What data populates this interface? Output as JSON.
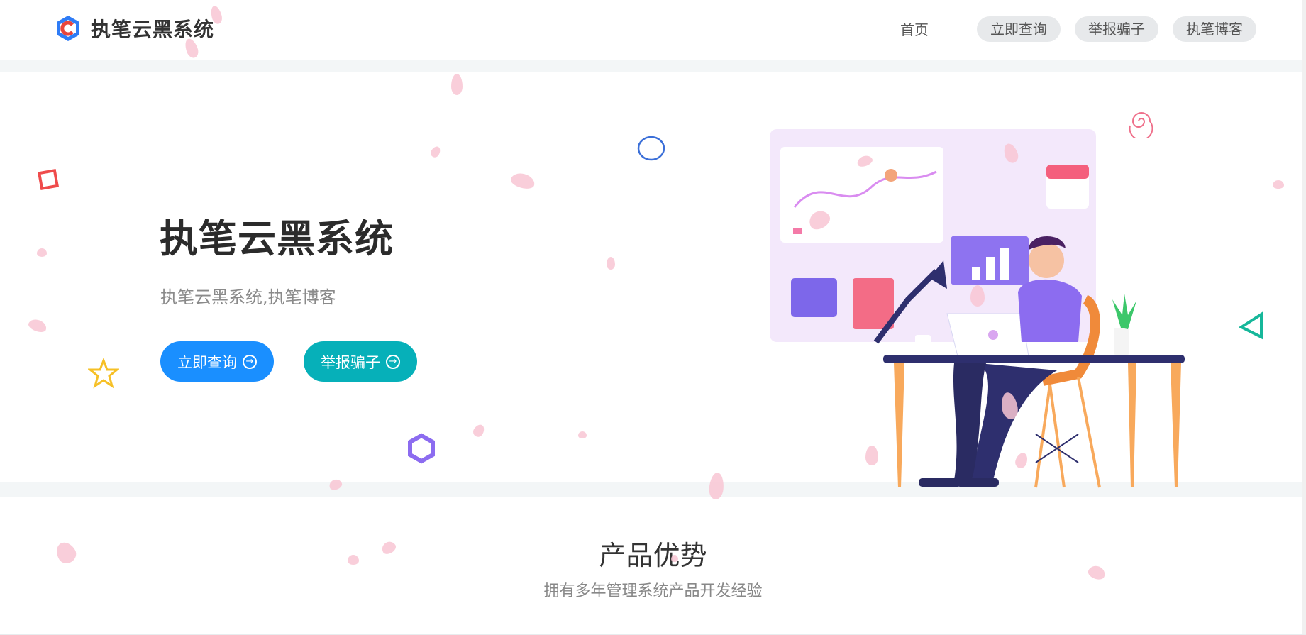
{
  "header": {
    "brand_name": "执笔云黑系统",
    "nav": {
      "home": "首页",
      "query": "立即查询",
      "report": "举报骗子",
      "blog": "执笔博客"
    }
  },
  "hero": {
    "title": "执笔云黑系统",
    "subtitle": "执笔云黑系统,执笔博客",
    "buttons": {
      "query": "立即查询",
      "report": "举报骗子"
    }
  },
  "advantages": {
    "title": "产品优势",
    "subtitle": "拥有多年管理系统产品开发经验"
  },
  "colors": {
    "primary_blue": "#1a8fff",
    "teal": "#06b0b9",
    "purple": "#8c6cf0"
  }
}
